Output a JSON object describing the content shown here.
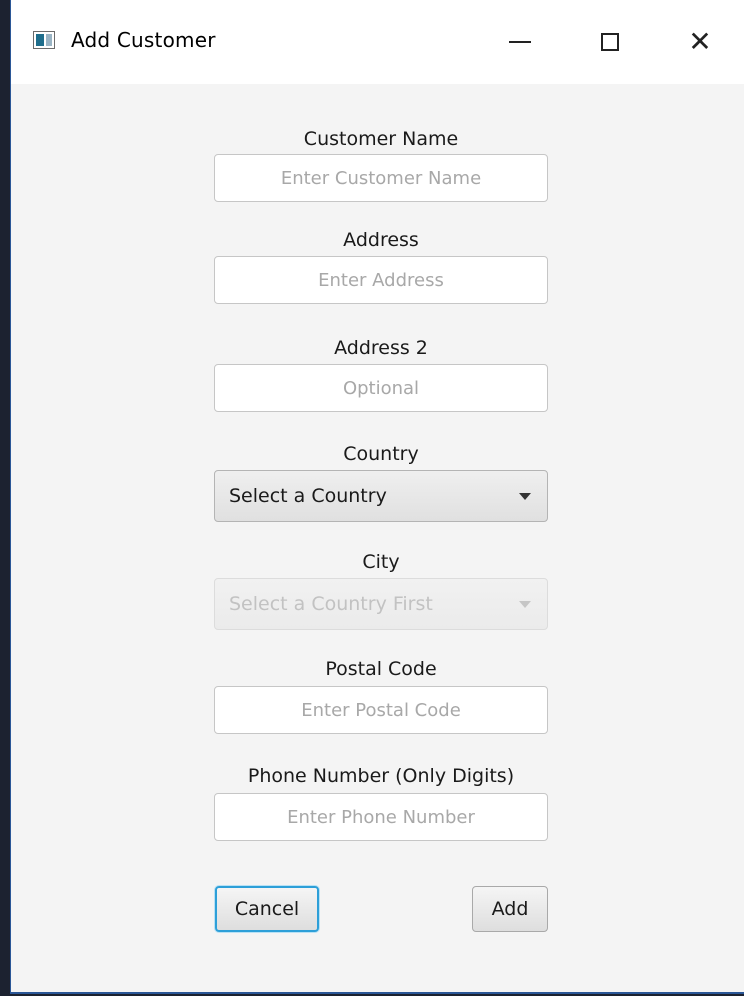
{
  "window": {
    "title": "Add Customer",
    "icon": "app-window-icon",
    "controls": {
      "minimize": "minimize-icon",
      "maximize": "maximize-icon",
      "close_glyph": "✕"
    }
  },
  "form": {
    "customer_name": {
      "label": "Customer Name",
      "placeholder": "Enter Customer Name",
      "value": ""
    },
    "address": {
      "label": "Address",
      "placeholder": "Enter Address",
      "value": ""
    },
    "address2": {
      "label": "Address 2",
      "placeholder": "Optional",
      "value": ""
    },
    "country": {
      "label": "Country",
      "selected": "Select a Country"
    },
    "city": {
      "label": "City",
      "selected": "Select a Country First",
      "disabled": true
    },
    "postal_code": {
      "label": "Postal Code",
      "placeholder": "Enter Postal Code",
      "value": ""
    },
    "phone": {
      "label": "Phone Number (Only Digits)",
      "placeholder": "Enter Phone Number",
      "value": ""
    }
  },
  "buttons": {
    "cancel": "Cancel",
    "add": "Add"
  },
  "colors": {
    "focus_ring": "#2d9fd8",
    "window_border": "#2b5797"
  }
}
